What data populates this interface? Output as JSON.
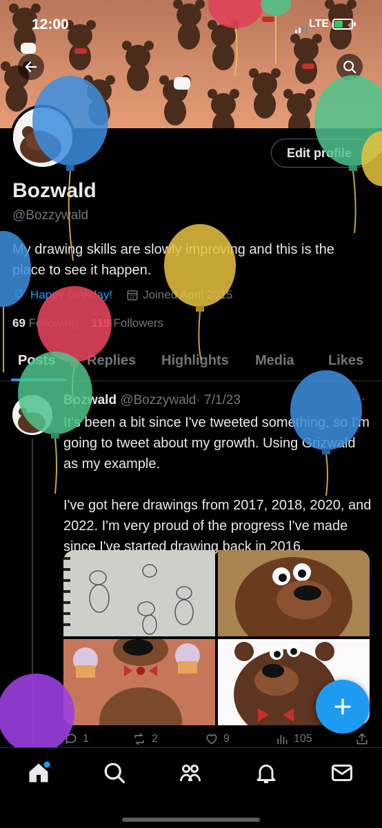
{
  "status_bar": {
    "time": "12:00",
    "network": "LTE"
  },
  "profile": {
    "name": "Bozwald",
    "handle": "@Bozzywald",
    "edit_label": "Edit profile",
    "bio": "My drawing skills are slowly improving and this is the place to see it happen.",
    "birthday": "Happy birthday!",
    "joined": "Joined April 2015",
    "following_count": "69",
    "following_label": "Following",
    "followers_count": "119",
    "followers_label": "Followers"
  },
  "tabs": [
    "Posts",
    "Replies",
    "Highlights",
    "Media",
    "Likes"
  ],
  "tweet": {
    "name": "Bozwald",
    "handle": "@Bozzywald",
    "date": "· 7/1/23",
    "para1": "It's been a bit since I've tweeted something, so I'm going to tweet about my growth. Using Grizwald as my example.",
    "para2": "I've got here drawings from 2017, 2018, 2020, and 2022. I'm very proud of the progress I've made since I've started drawing back in 2016.",
    "replies": "1",
    "reposts": "2",
    "likes": "9",
    "views": "105"
  },
  "icons": {
    "back": "back-arrow-icon",
    "search": "search-icon",
    "more": "more-icon",
    "compose": "plus-icon",
    "nav": [
      "home-icon",
      "search-icon",
      "communities-icon",
      "notifications-icon",
      "messages-icon"
    ]
  },
  "colors": {
    "accent": "#1d9bf0",
    "background": "#000000",
    "text": "#e7e9ea",
    "muted": "#71767b",
    "banner": "#d58f6d"
  }
}
